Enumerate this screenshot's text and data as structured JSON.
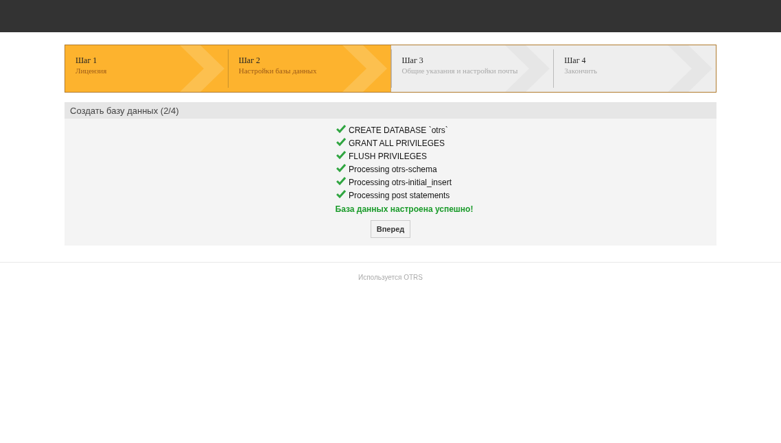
{
  "steps": [
    {
      "title": "Шаг 1",
      "subtitle": "Лицензия",
      "active": true
    },
    {
      "title": "Шаг 2",
      "subtitle": "Настройки базы данных",
      "active": true
    },
    {
      "title": "Шаг 3",
      "subtitle": "Общие указания и настройки почты",
      "active": false
    },
    {
      "title": "Шаг 4",
      "subtitle": "Закончить",
      "active": false
    }
  ],
  "panel": {
    "title": "Создать базу данных (2/4)",
    "results": [
      {
        "text": "CREATE DATABASE `otrs`",
        "done": true
      },
      {
        "text": "GRANT ALL PRIVILEGES",
        "done": true
      },
      {
        "text": "FLUSH PRIVILEGES",
        "done": true
      },
      {
        "text": "Processing otrs-schema",
        "done": true
      },
      {
        "text": "Processing otrs-initial_insert",
        "done": true
      },
      {
        "text": "Processing post statements",
        "done": true
      }
    ],
    "message": "База данных настроена успешно!",
    "button": "Вперед"
  },
  "footer": "Используется OTRS"
}
